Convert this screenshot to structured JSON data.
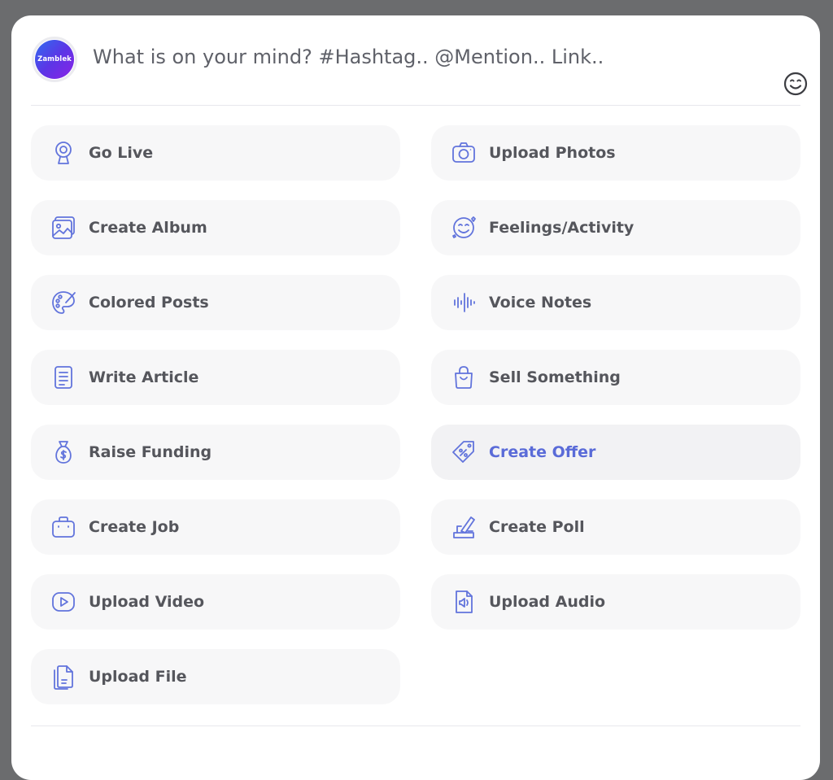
{
  "composer": {
    "avatar_text": "Zamblek",
    "placeholder": "What is on your mind? #Hashtag.. @Mention.. Link.."
  },
  "colors": {
    "icon_accent": "#6274dc",
    "label": "#55565c",
    "active_label": "#5a6bd8",
    "option_bg": "#f7f7f8",
    "backdrop": "#6b6c6e"
  },
  "options": [
    {
      "label": "Go Live",
      "icon": "webcam-icon"
    },
    {
      "label": "Upload Photos",
      "icon": "camera-icon"
    },
    {
      "label": "Create Album",
      "icon": "gallery-icon"
    },
    {
      "label": "Feelings/Activity",
      "icon": "smiley-icon"
    },
    {
      "label": "Colored Posts",
      "icon": "palette-icon"
    },
    {
      "label": "Voice Notes",
      "icon": "soundwave-icon"
    },
    {
      "label": "Write Article",
      "icon": "document-icon"
    },
    {
      "label": "Sell Something",
      "icon": "shopping-bag-icon"
    },
    {
      "label": "Raise Funding",
      "icon": "money-bag-icon"
    },
    {
      "label": "Create Offer",
      "icon": "discount-tag-icon",
      "active": true
    },
    {
      "label": "Create Job",
      "icon": "briefcase-icon"
    },
    {
      "label": "Create Poll",
      "icon": "ballot-box-icon"
    },
    {
      "label": "Upload Video",
      "icon": "video-play-icon"
    },
    {
      "label": "Upload Audio",
      "icon": "audio-file-icon"
    },
    {
      "label": "Upload File",
      "icon": "file-icon"
    }
  ]
}
